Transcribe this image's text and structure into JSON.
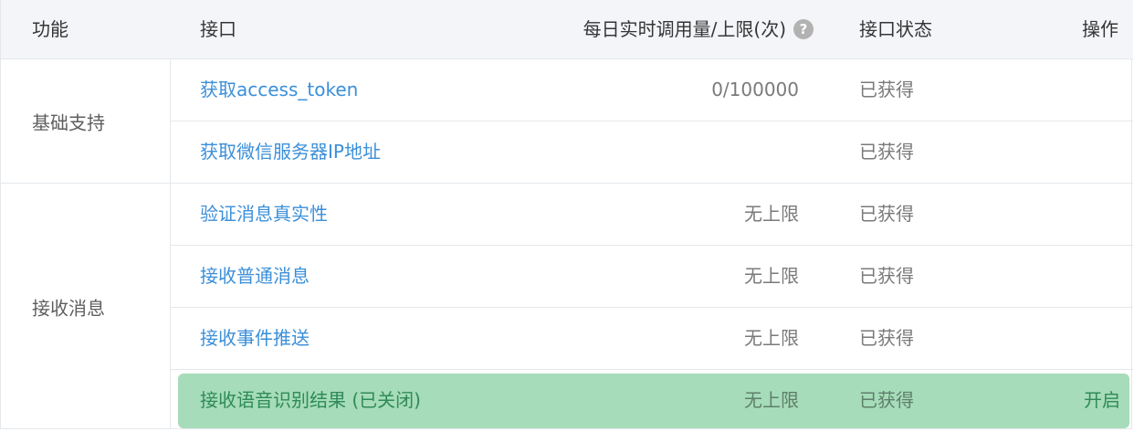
{
  "header": {
    "func": "功能",
    "api": "接口",
    "quota": "每日实时调用量/上限(次)",
    "help": "?",
    "status": "接口状态",
    "operation": "操作"
  },
  "groups": [
    {
      "label": "基础支持"
    },
    {
      "label": "接收消息"
    }
  ],
  "rows": [
    {
      "api": "获取access_token",
      "quota": "0/100000",
      "status": "已获得",
      "op": ""
    },
    {
      "api": "获取微信服务器IP地址",
      "quota": "",
      "status": "已获得",
      "op": ""
    },
    {
      "api": "验证消息真实性",
      "quota": "无上限",
      "status": "已获得",
      "op": ""
    },
    {
      "api": "接收普通消息",
      "quota": "无上限",
      "status": "已获得",
      "op": ""
    },
    {
      "api": "接收事件推送",
      "quota": "无上限",
      "status": "已获得",
      "op": ""
    },
    {
      "api": "接收语音识别结果 (已关闭)",
      "quota": "无上限",
      "status": "已获得",
      "op": "开启"
    }
  ],
  "colors": {
    "link": "#3b8fd9",
    "highlight_bg": "#a6dcb9",
    "header_bg": "#f4f5f9"
  }
}
